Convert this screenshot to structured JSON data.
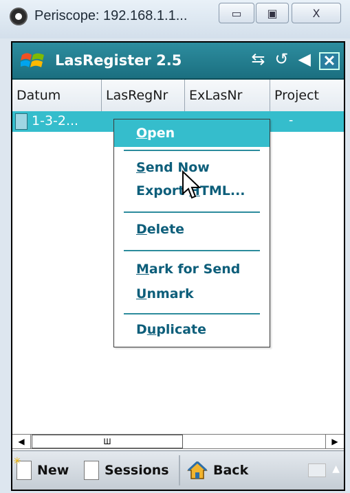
{
  "host_window": {
    "title": "Periscope: 192.168.1.1...",
    "icon": "eye-icon",
    "buttons": {
      "minimize": "▭",
      "maximize": "▣",
      "close": "X"
    }
  },
  "app": {
    "title": "LasRegister 2.5",
    "tray_icons": [
      "connectivity-icon",
      "sync-icon",
      "volume-icon"
    ],
    "tray_glyphs": {
      "connectivity": "⇆",
      "sync": "↺",
      "volume": "◀"
    },
    "close_label": "✕"
  },
  "table": {
    "columns": [
      "Datum",
      "LasRegNr",
      "ExLasNr",
      "Project"
    ],
    "rows": [
      {
        "datum": "1-3-2...",
        "lasregnr": "",
        "exlasnr": "",
        "project": "-"
      }
    ]
  },
  "context_menu": {
    "items": [
      {
        "label": "Open",
        "accel": "O",
        "rest": "pen",
        "highlighted": true
      },
      {
        "label": "Send Now",
        "accel": "S",
        "rest": "end Now"
      },
      {
        "label": "Export HTML...",
        "pre": "Export ",
        "accel": "H",
        "rest": "TML..."
      },
      {
        "label": "Delete",
        "accel": "D",
        "rest": "elete"
      },
      {
        "label": "Mark for Send",
        "accel": "M",
        "rest": "ark for Send"
      },
      {
        "label": "Unmark",
        "accel": "U",
        "rest": "nmark"
      },
      {
        "label": "Duplicate",
        "pre": "D",
        "accel": "u",
        "rest": "plicate"
      }
    ]
  },
  "scrollbar": {
    "left": "◀",
    "right": "▶",
    "thumb": "Ш"
  },
  "softkeys": {
    "new": "New",
    "sessions": "Sessions",
    "back": "Back"
  },
  "colors": {
    "accent": "#35bdcc",
    "menu_text": "#0d5e7a",
    "taskbar": "#1b6f80"
  }
}
